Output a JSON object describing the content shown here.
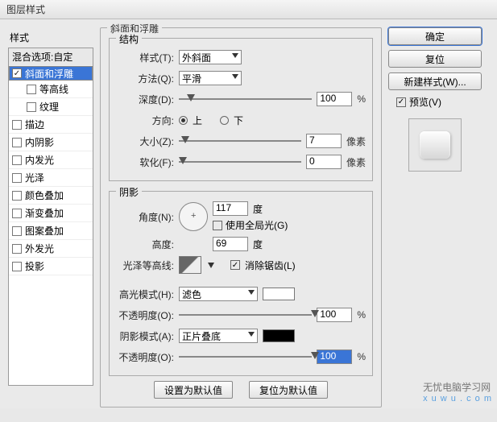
{
  "title": "图层样式",
  "left": {
    "heading": "样式",
    "blending": "混合选项:自定",
    "items": [
      "斜面和浮雕",
      "等高线",
      "纹理",
      "描边",
      "内阴影",
      "内发光",
      "光泽",
      "颜色叠加",
      "渐变叠加",
      "图案叠加",
      "外发光",
      "投影"
    ]
  },
  "mid": {
    "group_title": "斜面和浮雕",
    "pct": "%",
    "px": "像素",
    "deg": "度",
    "structure": {
      "title": "结构",
      "style_label": "样式(T):",
      "style_value": "外斜面",
      "technique_label": "方法(Q):",
      "technique_value": "平滑",
      "depth_label": "深度(D):",
      "depth_value": "100",
      "dir_label": "方向:",
      "dir_up": "上",
      "dir_down": "下",
      "size_label": "大小(Z):",
      "size_value": "7",
      "soften_label": "软化(F):",
      "soften_value": "0"
    },
    "shading": {
      "title": "阴影",
      "angle_label": "角度(N):",
      "angle_value": "117",
      "global_light": "使用全局光(G)",
      "altitude_label": "高度:",
      "altitude_value": "69",
      "gloss_contour_label": "光泽等高线:",
      "antialias": "消除锯齿(L)",
      "highlight_mode_label": "高光模式(H):",
      "highlight_mode_value": "滤色",
      "opacity_label": "不透明度(O):",
      "highlight_opacity": "100",
      "shadow_mode_label": "阴影模式(A):",
      "shadow_mode_value": "正片叠底",
      "shadow_opacity": "100"
    },
    "buttons": {
      "make_default": "设置为默认值",
      "reset_default": "复位为默认值"
    }
  },
  "right": {
    "ok": "确定",
    "cancel": "复位",
    "new_style": "新建样式(W)...",
    "preview": "预览(V)"
  },
  "watermark": {
    "line1": "无忧电脑学习网",
    "line2": "x u w u . c o m"
  }
}
